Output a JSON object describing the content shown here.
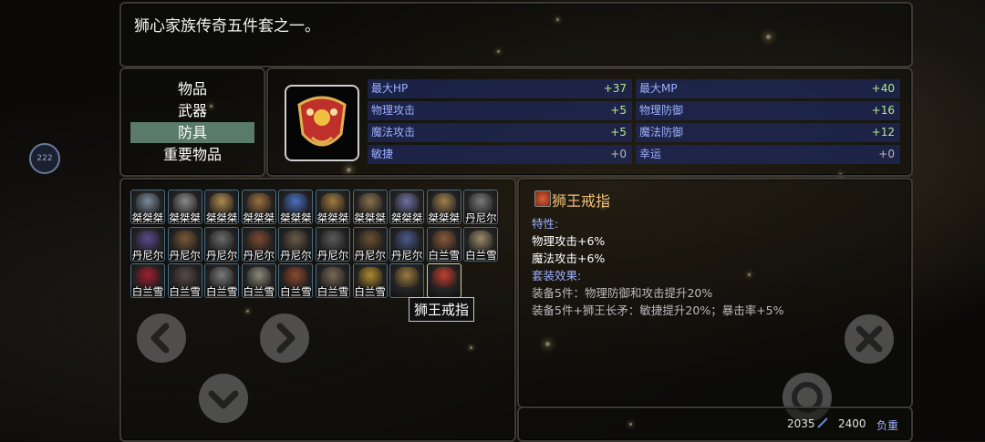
{
  "description": "狮心家族传奇五件套之一。",
  "categories": [
    {
      "label": "物品",
      "active": false
    },
    {
      "label": "武器",
      "active": false
    },
    {
      "label": "防具",
      "active": true
    },
    {
      "label": "重要物品",
      "active": false
    }
  ],
  "stats": [
    {
      "label": "最大HP",
      "value": "+37"
    },
    {
      "label": "最大MP",
      "value": "+40"
    },
    {
      "label": "物理攻击",
      "value": "+5"
    },
    {
      "label": "物理防御",
      "value": "+16"
    },
    {
      "label": "魔法攻击",
      "value": "+5"
    },
    {
      "label": "魔法防御",
      "value": "+12"
    },
    {
      "label": "敏捷",
      "value": "+0"
    },
    {
      "label": "幸运",
      "value": "+0"
    }
  ],
  "inventory": [
    {
      "name": "桀桀桀",
      "color": "#7a8a9a"
    },
    {
      "name": "桀桀桀",
      "color": "#8a8a8a"
    },
    {
      "name": "桀桀桀",
      "color": "#b08a50"
    },
    {
      "name": "桀桀桀",
      "color": "#9a7040"
    },
    {
      "name": "桀桀桀",
      "color": "#4a70c0"
    },
    {
      "name": "桀桀桀",
      "color": "#a07a40"
    },
    {
      "name": "桀桀桀",
      "color": "#8a7050"
    },
    {
      "name": "桀桀桀",
      "color": "#7070a0"
    },
    {
      "name": "桀桀桀",
      "color": "#a08050"
    },
    {
      "name": "丹尼尔",
      "color": "#7a7a7a"
    },
    {
      "name": "丹尼尔",
      "color": "#5a4a8a"
    },
    {
      "name": "丹尼尔",
      "color": "#7a5a3a"
    },
    {
      "name": "丹尼尔",
      "color": "#6a6a6a"
    },
    {
      "name": "丹尼尔",
      "color": "#7a4a30"
    },
    {
      "name": "丹尼尔",
      "color": "#6a5a4a"
    },
    {
      "name": "丹尼尔",
      "color": "#5a5a5a"
    },
    {
      "name": "丹尼尔",
      "color": "#6a5030"
    },
    {
      "name": "丹尼尔",
      "color": "#4a5a8a"
    },
    {
      "name": "白兰雪",
      "color": "#8a5a3a"
    },
    {
      "name": "白兰雪",
      "color": "#9a8a6a"
    },
    {
      "name": "白兰雪",
      "color": "#a02030"
    },
    {
      "name": "白兰雪",
      "color": "#5a4a4a"
    },
    {
      "name": "白兰雪",
      "color": "#7a7a7a"
    },
    {
      "name": "白兰雪",
      "color": "#8a8a7a"
    },
    {
      "name": "白兰雪",
      "color": "#8a4a30"
    },
    {
      "name": "白兰雪",
      "color": "#7a6a5a"
    },
    {
      "name": "白兰雪",
      "color": "#b08a30"
    },
    {
      "name": "",
      "color": "#9a7a40"
    },
    {
      "name": "",
      "color": "#c04030",
      "selected": true
    }
  ],
  "tooltip": "狮王戒指",
  "detail": {
    "title": "狮王戒指",
    "trait_header": "特性:",
    "trait_1": "物理攻击+6%",
    "trait_2": "魔法攻击+6%",
    "set_header": "套装效果:",
    "set_1": "装备5件：物理防御和攻击提升20%",
    "set_2": "装备5件+狮王长矛：敏捷提升20%；暴击率+5%"
  },
  "weight": {
    "current": "2035",
    "max": "2400",
    "label": "负重"
  },
  "side_badge": "222",
  "icons": [
    "chevron-left-icon",
    "chevron-right-icon",
    "chevron-down-icon",
    "close-icon",
    "action-ring-icon"
  ]
}
